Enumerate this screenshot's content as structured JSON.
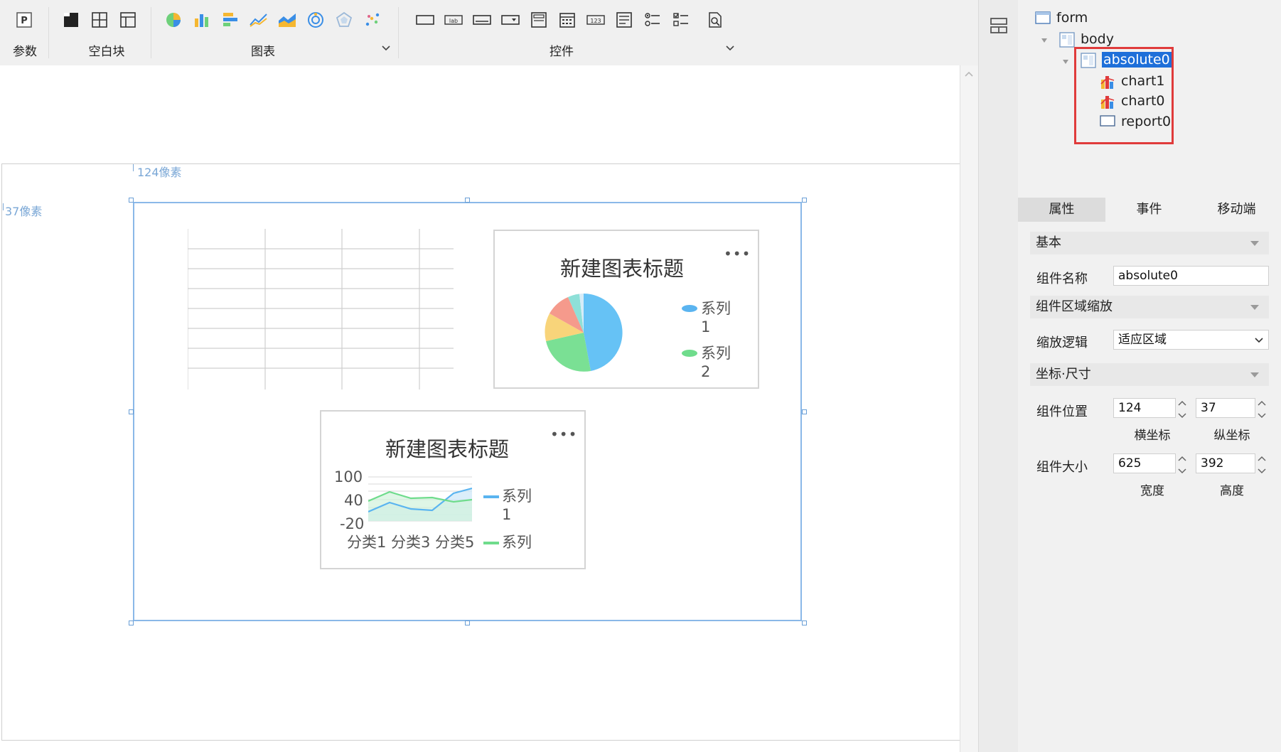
{
  "toolbar": {
    "groups": {
      "params": "参数",
      "blank": "空白块",
      "charts": "图表",
      "controls": "控件"
    }
  },
  "canvas": {
    "ruler_x": "124像素",
    "ruler_y": "37像素"
  },
  "charts": {
    "pie": {
      "title": "新建图表标题",
      "menu": "•••",
      "legend": [
        {
          "name": "系列",
          "suffix": "1",
          "color": "#5ab4f0"
        },
        {
          "name": "系列",
          "suffix": "2",
          "color": "#6fdc8c"
        }
      ]
    },
    "line": {
      "title": "新建图表标题",
      "menu": "•••",
      "y_ticks": [
        "100",
        "40",
        "-20"
      ],
      "x_ticks": [
        "分类1",
        "分类3",
        "分类5"
      ],
      "legend": [
        {
          "name": "系列",
          "suffix": "1",
          "color": "#5ab4f0"
        },
        {
          "name": "系列",
          "suffix": "",
          "color": "#6fdc8c"
        }
      ]
    }
  },
  "tree": {
    "form": "form",
    "body": "body",
    "absolute0": "absolute0",
    "chart1": "chart1",
    "chart0": "chart0",
    "report0": "report0"
  },
  "tabs": [
    "属性",
    "事件",
    "移动端"
  ],
  "properties": {
    "section_basic": "基本",
    "name_label": "组件名称",
    "name_value": "absolute0",
    "section_scale": "组件区域缩放",
    "scale_logic_label": "缩放逻辑",
    "scale_logic_value": "适应区域",
    "section_coords": "坐标·尺寸",
    "position_label": "组件位置",
    "pos_x": "124",
    "pos_y": "37",
    "x_label": "横坐标",
    "y_label": "纵坐标",
    "size_label": "组件大小",
    "width": "625",
    "height": "392",
    "width_label": "宽度",
    "height_label": "高度"
  },
  "colors": {
    "accent": "#1e6fd9",
    "highlight_box": "#e03b3b",
    "selection_border": "#8ab8e8"
  }
}
